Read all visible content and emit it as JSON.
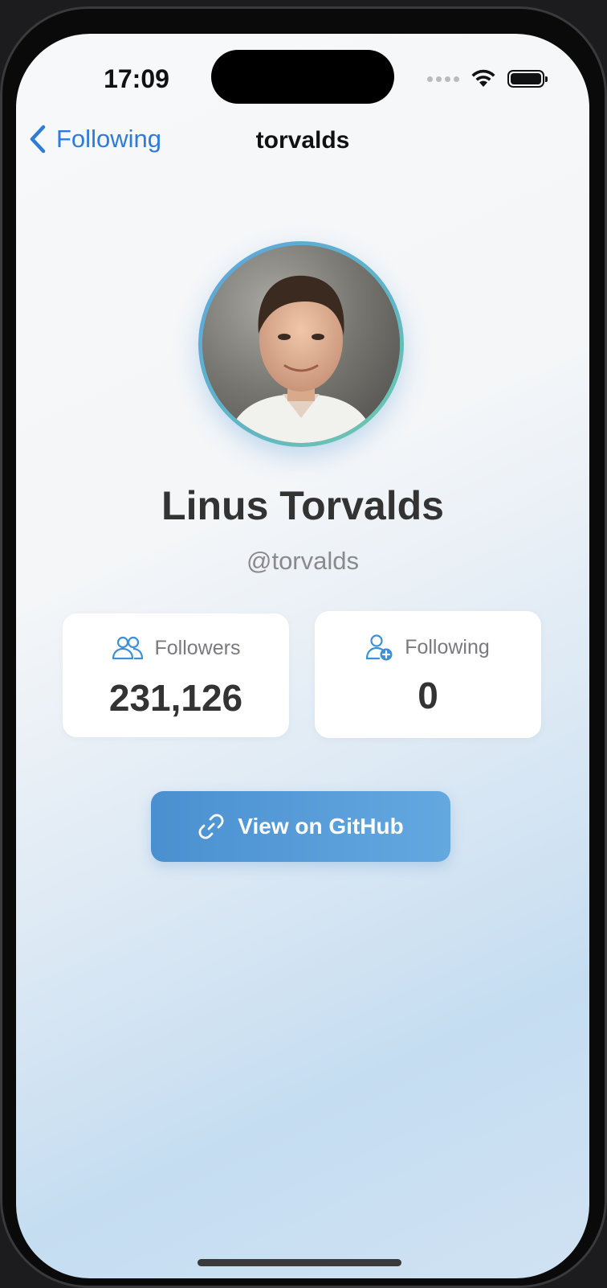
{
  "status_bar": {
    "time": "17:09"
  },
  "nav": {
    "back_label": "Following",
    "title": "torvalds"
  },
  "profile": {
    "name": "Linus Torvalds",
    "handle": "@torvalds"
  },
  "stats": {
    "followers": {
      "label": "Followers",
      "value": "231,126",
      "icon": "people-icon"
    },
    "following": {
      "label": "Following",
      "value": "0",
      "icon": "person-add-icon"
    }
  },
  "actions": {
    "github_button_label": "View on GitHub",
    "github_icon": "link-icon"
  },
  "colors": {
    "accent": "#2f7bd8",
    "button": "#5a9fda"
  }
}
